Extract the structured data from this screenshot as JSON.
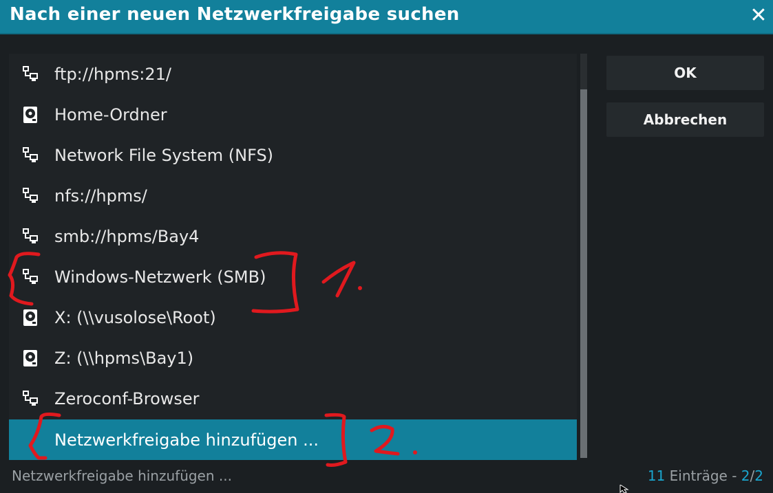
{
  "dialog": {
    "title": "Nach einer neuen Netzwerkfreigabe suchen",
    "close_label": "✕"
  },
  "list": {
    "items": [
      {
        "label": "ftp://hpms:21/",
        "icon": "network-icon"
      },
      {
        "label": "Home-Ordner",
        "icon": "harddisk-icon"
      },
      {
        "label": "Network File System (NFS)",
        "icon": "network-icon"
      },
      {
        "label": "nfs://hpms/",
        "icon": "network-icon"
      },
      {
        "label": "smb://hpms/Bay4",
        "icon": "network-icon"
      },
      {
        "label": "Windows-Netzwerk (SMB)",
        "icon": "network-icon"
      },
      {
        "label": "X: (\\\\vusolose\\Root)",
        "icon": "harddisk-icon"
      },
      {
        "label": "Z: (\\\\hpms\\Bay1)",
        "icon": "harddisk-icon"
      },
      {
        "label": "Zeroconf-Browser",
        "icon": "network-icon"
      },
      {
        "label": "Netzwerkfreigabe hinzufügen ...",
        "icon": ""
      }
    ],
    "focused_index": 9
  },
  "buttons": {
    "ok": "OK",
    "cancel": "Abbrechen"
  },
  "status": {
    "selected_label": "Netzwerkfreigabe hinzufügen ...",
    "count": "11",
    "entries_text": " Einträge - ",
    "page_current": "2",
    "page_sep": "/",
    "page_total": "2"
  },
  "annotations": {
    "mark1": "1.",
    "mark2": "2.",
    "color": "#e0191e"
  },
  "colors": {
    "accent": "#12809b",
    "background": "#1b1f22",
    "panel": "#1f2326",
    "button": "#252a2d"
  }
}
